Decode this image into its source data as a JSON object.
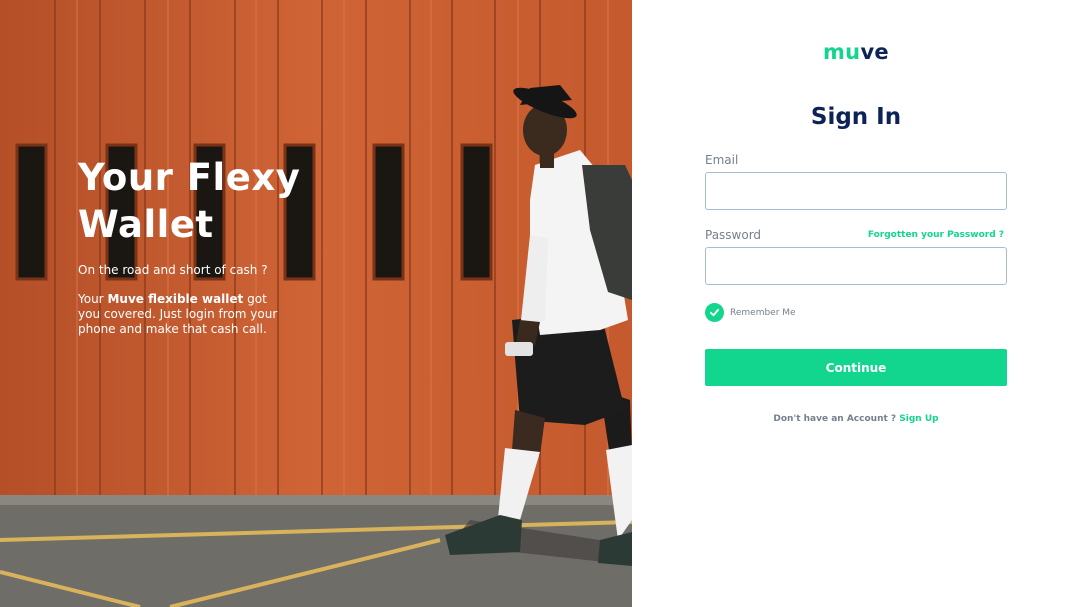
{
  "hero": {
    "title_line1": "Your Flexy",
    "title_line2": "Wallet",
    "tagline": "On the road and short of cash ?",
    "desc_prefix": "Your",
    "desc_bold": "Muve flexible wallet",
    "desc_suffix": "got you covered. Just login from your phone and make that cash call."
  },
  "brand": {
    "logo_part1": "mu",
    "logo_part2": "ve"
  },
  "form": {
    "title": "Sign In",
    "email_label": "Email",
    "email_value": "",
    "password_label": "Password",
    "password_value": "",
    "forgot_link": "Forgotten your Password ?",
    "remember_label": "Remember Me",
    "remember_checked": true,
    "continue_label": "Continue",
    "no_account_text": "Don't have an Account ?",
    "signup_link": "Sign Up"
  },
  "colors": {
    "accent": "#12d68e",
    "navy": "#0d2257",
    "hero_orange": "#c65a2e"
  }
}
